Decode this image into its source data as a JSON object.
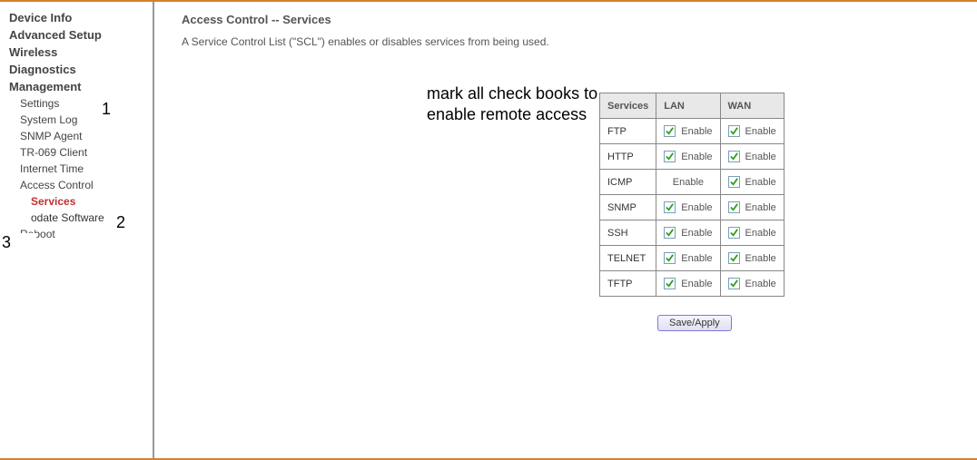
{
  "sidebar": {
    "device_info": "Device Info",
    "advanced_setup": "Advanced Setup",
    "wireless": "Wireless",
    "diagnostics": "Diagnostics",
    "management": "Management",
    "mgmt_items": {
      "settings": "Settings",
      "system_log": "System Log",
      "snmp_agent": "SNMP Agent",
      "tr069": "TR-069 Client",
      "internet_time": "Internet Time",
      "access_control": "Access Control",
      "ac_services": "Services",
      "update_software": "odate Software",
      "reboot": "Reboot"
    }
  },
  "annotations": {
    "num1": "1",
    "num2": "2",
    "num3": "3",
    "text": "mark all check books to enable remote access"
  },
  "page": {
    "title": "Access Control -- Services",
    "desc": "A Service Control List (\"SCL\") enables or disables services from being used."
  },
  "table": {
    "headers": {
      "services": "Services",
      "lan": "LAN",
      "wan": "WAN"
    },
    "enable_label": "Enable",
    "rows": [
      {
        "name": "FTP",
        "lan_check": true,
        "wan_check": true
      },
      {
        "name": "HTTP",
        "lan_check": true,
        "wan_check": true
      },
      {
        "name": "ICMP",
        "lan_check": null,
        "wan_check": true
      },
      {
        "name": "SNMP",
        "lan_check": true,
        "wan_check": true
      },
      {
        "name": "SSH",
        "lan_check": true,
        "wan_check": true
      },
      {
        "name": "TELNET",
        "lan_check": true,
        "wan_check": true
      },
      {
        "name": "TFTP",
        "lan_check": true,
        "wan_check": true
      }
    ]
  },
  "buttons": {
    "save": "Save/Apply"
  }
}
